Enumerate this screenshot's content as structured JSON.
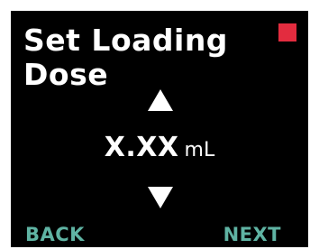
{
  "screen": {
    "title_line1": "Set Loading",
    "title_line2": "Dose",
    "status_indicator_color": "#e32c3f",
    "value": "X.XX",
    "unit": "mL",
    "increase_icon": "triangle-up-icon",
    "decrease_icon": "triangle-down-icon"
  },
  "softkeys": {
    "back_label": "BACK",
    "next_label": "NEXT",
    "color": "#5fb3a3"
  }
}
